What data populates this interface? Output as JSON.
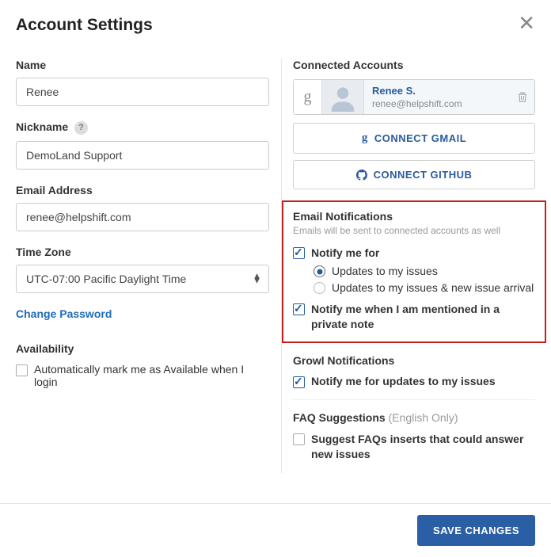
{
  "header": {
    "title": "Account Settings"
  },
  "form": {
    "name": {
      "label": "Name",
      "value": "Renee"
    },
    "nickname": {
      "label": "Nickname",
      "help": "?",
      "value": "DemoLand Support"
    },
    "email": {
      "label": "Email Address",
      "value": "renee@helpshift.com"
    },
    "timezone": {
      "label": "Time Zone",
      "value": "UTC-07:00 Pacific Daylight Time"
    },
    "change_password": "Change Password",
    "availability": {
      "title": "Availability",
      "auto_available": "Automatically mark me as Available when I login"
    }
  },
  "connected": {
    "title": "Connected Accounts",
    "account": {
      "provider_letter": "g",
      "name": "Renee S.",
      "email": "renee@helpshift.com"
    },
    "connect_gmail": "CONNECT GMAIL",
    "connect_github": "CONNECT GITHUB"
  },
  "email_notif": {
    "title": "Email Notifications",
    "subtitle": "Emails will be sent to connected accounts as well",
    "notify_for": "Notify me for",
    "opt_updates": "Updates to my issues",
    "opt_updates_new": "Updates to my issues & new issue arrival",
    "notify_mention": "Notify me when I am mentioned in a private note"
  },
  "growl": {
    "title": "Growl Notifications",
    "notify_updates": "Notify me for updates to my issues"
  },
  "faq": {
    "title": "FAQ Suggestions",
    "title_note": "(English Only)",
    "suggest": "Suggest FAQs inserts that could answer new issues"
  },
  "footer": {
    "save": "SAVE CHANGES"
  }
}
